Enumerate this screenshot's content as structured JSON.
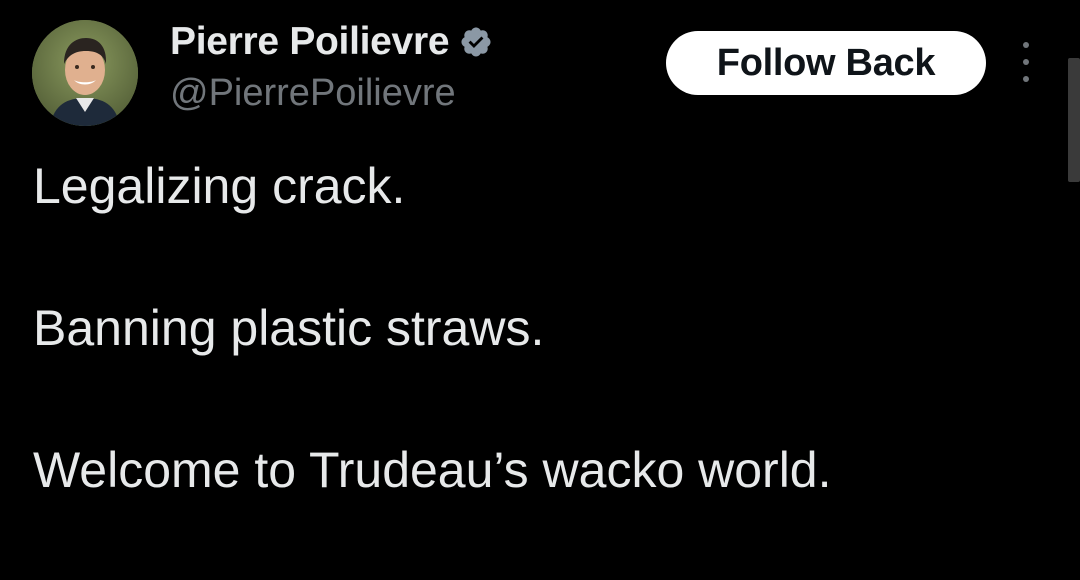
{
  "author": {
    "display_name": "Pierre Poilievre",
    "handle": "@PierrePoilievre",
    "verified": true,
    "verified_badge_color": "#8b98a5"
  },
  "actions": {
    "follow_label": "Follow Back",
    "more_icon": "more-vertical-icon"
  },
  "tweet": {
    "lines": [
      "Legalizing crack.",
      "Banning plastic straws.",
      "Welcome to Trudeau’s wacko world."
    ]
  },
  "colors": {
    "background": "#000000",
    "text_primary": "#e7e9ea",
    "text_secondary": "#71767b",
    "button_bg": "#ffffff",
    "button_text": "#0f1419"
  }
}
